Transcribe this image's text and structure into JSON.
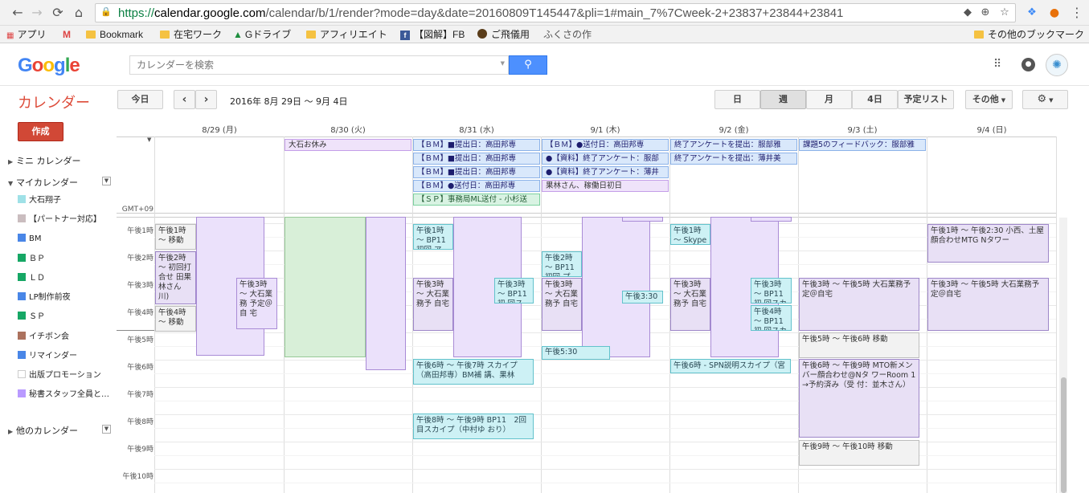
{
  "browser": {
    "url_scheme": "https://",
    "url_host": "calendar.google.com",
    "url_path": "/calendar/b/1/render?mode=day&date=20160809T145447&pli=1#main_7%7Cweek-2+23837+23844+23841",
    "bookmarks": [
      {
        "label": "アプリ",
        "icon": "apps-grid-icon"
      },
      {
        "label": "",
        "icon": "gmail-icon"
      },
      {
        "label": "Bookmark",
        "icon": "folder-icon"
      },
      {
        "label": "在宅ワーク",
        "icon": "folder-icon"
      },
      {
        "label": "Gドライブ",
        "icon": "drive-icon"
      },
      {
        "label": "アフィリエイト",
        "icon": "folder-icon"
      },
      {
        "label": "【図解】FB",
        "icon": "facebook-icon"
      },
      {
        "label": "ご飛儀用",
        "icon": "site-icon"
      },
      {
        "label": "ふくさの作",
        "icon": "none"
      }
    ],
    "other_bookmarks": "その他のブックマーク"
  },
  "header": {
    "logo": "Google",
    "search_placeholder": "カレンダーを検索"
  },
  "toolbar": {
    "app_title": "カレンダー",
    "today": "今日",
    "prev": "‹",
    "next": "›",
    "date_range": "2016年 8月 29日 ～ 9月 4日",
    "views": {
      "day": "日",
      "week": "週",
      "month": "月",
      "four_day": "4日",
      "agenda": "予定リスト"
    },
    "more": "その他",
    "settings_arrow": "▾"
  },
  "sidebar": {
    "create": "作成",
    "mini_calendar": "ミニ カレンダー",
    "my_calendars": "マイカレンダー",
    "other_calendars": "他のカレンダー",
    "calendars": [
      {
        "name": "大石翔子",
        "color": "#9fe1e7"
      },
      {
        "name": "【パートナー対応】",
        "color": "#cabdbf"
      },
      {
        "name": "BM",
        "color": "#4986e7"
      },
      {
        "name": "ＢＰ",
        "color": "#16a765"
      },
      {
        "name": "ＬＤ",
        "color": "#16a765"
      },
      {
        "name": "LP制作前夜",
        "color": "#4986e7"
      },
      {
        "name": "ＳＰ",
        "color": "#16a765"
      },
      {
        "name": "イチボン会",
        "color": "#ac725e"
      },
      {
        "name": "リマインダー",
        "color": "#4986e7"
      },
      {
        "name": "出版プロモーション",
        "color": "#ffffff"
      },
      {
        "name": "秘書スタッフ全員と…",
        "color": "#b99aff"
      }
    ]
  },
  "grid": {
    "timezone": "GMT+09",
    "days": [
      "8/29 (月)",
      "8/30 (火)",
      "8/31 (水)",
      "9/1 (木)",
      "9/2 (金)",
      "9/3 (土)",
      "9/4 (日)"
    ],
    "hours": [
      "午後1時",
      "午後2時",
      "午後3時",
      "午後4時",
      "午後5時",
      "午後6時",
      "午後7時",
      "午後8時",
      "午後9時",
      "午後10時"
    ],
    "allday": {
      "a1": "大石お休み",
      "b1": "【ＢＭ】■提出日：高田邦専",
      "b2": "【ＢＭ】■提出日：高田邦専",
      "b3": "【ＢＭ】■提出日：高田邦専",
      "b4": "【ＢＭ】●送付日：高田邦専",
      "b5": "【ＳＰ】事務局ML送付 - 小杉送",
      "c1": "【ＢＭ】●送付日：高田邦専",
      "c2": "●【資料】終了アンケート：服部",
      "c3": "●【資料】終了アンケート：薄井",
      "c4": "果林さん、稼働日初日",
      "d1": "終了アンケートを提出：服部雅",
      "d2": "終了アンケートを提出：薄井美",
      "e1": "課題5のフィードバック：服部雅"
    },
    "events": {
      "m1": "午後1時 ～ 移動",
      "m2": "午後2時 ～ 初回打合せ 田果林さん 川)",
      "m3": "午後4時 ～ 移動",
      "m4": "午後3時 ～ 大石業務 予定＠自 宅",
      "w1": "午後1時 ～ BP11 初回 ア（米田ア",
      "w2": "午後3時 ～ 大石業務予 自宅",
      "w3": "午後3時 ～ BP11 初 回スカイ",
      "w4": "午後6時 ～ 午後7時 スカイプ（高田邦専）BM補 講、果林",
      "w5": "午後8時 ～ 午後9時 BP11　2回目スカイプ（中村ゆ おり）",
      "t1": "午後2時 ～ BP11 初回 プ（小浅旦",
      "t2": "午後3時 ～ 大石業務予 自宅",
      "t3": "午後3:30",
      "t4": "午後5:30",
      "f1": "午後1時 ～ Skypeコン",
      "f2": "午後3時 ～ 大石業務予 自宅",
      "f3": "午後3時 ～ BP11 初 回スカイ",
      "f4": "午後4時 ～ BP11 初 回スカイ",
      "f5": "午後6時 - SPN説明スカイプ（宮",
      "s1": "午後3時 ～ 午後5時 大石業務予定＠自宅",
      "s2": "午後5時 ～ 午後6時 移動",
      "s3": "午後6時 ～ 午後9時 MTO新メンバー顔合わせ@Nタ ワーRoom 1　→予約済み（受 付：並木さん）",
      "s4": "午後9時 ～ 午後10時 移動",
      "u1": "午後1時 ～ 午後2:30 小西、土屋顔合わせMTG Nタワー",
      "u2": "午後3時 ～ 午後5時 大石業務予定＠自宅"
    }
  }
}
